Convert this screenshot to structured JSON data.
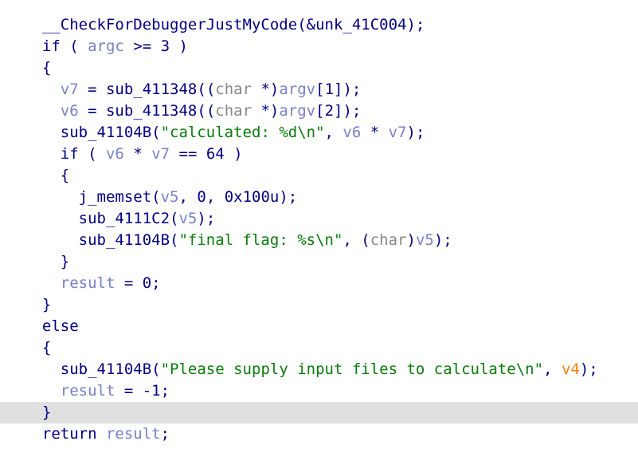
{
  "gutter_numbers": [
    "",
    "",
    "",
    "",
    "",
    "",
    "",
    "",
    "",
    "",
    "",
    "",
    "",
    "",
    "",
    "",
    "",
    "",
    "",
    ""
  ],
  "code_lines": [
    [
      {
        "t": "  ",
        "c": "punc"
      },
      {
        "t": "__CheckForDebuggerJustMyCode",
        "c": "fn"
      },
      {
        "t": "(&unk_41C004);",
        "c": "punc"
      }
    ],
    [
      {
        "t": "  ",
        "c": "punc"
      },
      {
        "t": "if",
        "c": "kw"
      },
      {
        "t": " ( ",
        "c": "punc"
      },
      {
        "t": "argc",
        "c": "var"
      },
      {
        "t": " >= 3 )",
        "c": "punc"
      }
    ],
    [
      {
        "t": "  {",
        "c": "punc"
      }
    ],
    [
      {
        "t": "    ",
        "c": "punc"
      },
      {
        "t": "v7",
        "c": "var"
      },
      {
        "t": " = ",
        "c": "punc"
      },
      {
        "t": "sub_411348",
        "c": "fn"
      },
      {
        "t": "((",
        "c": "punc"
      },
      {
        "t": "char",
        "c": "gray"
      },
      {
        "t": " *)",
        "c": "punc"
      },
      {
        "t": "argv",
        "c": "var"
      },
      {
        "t": "[1]);",
        "c": "punc"
      }
    ],
    [
      {
        "t": "    ",
        "c": "punc"
      },
      {
        "t": "v6",
        "c": "var"
      },
      {
        "t": " = ",
        "c": "punc"
      },
      {
        "t": "sub_411348",
        "c": "fn"
      },
      {
        "t": "((",
        "c": "punc"
      },
      {
        "t": "char",
        "c": "gray"
      },
      {
        "t": " *)",
        "c": "punc"
      },
      {
        "t": "argv",
        "c": "var"
      },
      {
        "t": "[2]);",
        "c": "punc"
      }
    ],
    [
      {
        "t": "    ",
        "c": "punc"
      },
      {
        "t": "sub_41104B",
        "c": "fn"
      },
      {
        "t": "(",
        "c": "punc"
      },
      {
        "t": "\"calculated: %d\\n\"",
        "c": "str"
      },
      {
        "t": ", ",
        "c": "punc"
      },
      {
        "t": "v6",
        "c": "var"
      },
      {
        "t": " * ",
        "c": "punc"
      },
      {
        "t": "v7",
        "c": "var"
      },
      {
        "t": ");",
        "c": "punc"
      }
    ],
    [
      {
        "t": "    ",
        "c": "punc"
      },
      {
        "t": "if",
        "c": "kw"
      },
      {
        "t": " ( ",
        "c": "punc"
      },
      {
        "t": "v6",
        "c": "var"
      },
      {
        "t": " * ",
        "c": "punc"
      },
      {
        "t": "v7",
        "c": "var"
      },
      {
        "t": " == 64 )",
        "c": "punc"
      }
    ],
    [
      {
        "t": "    {",
        "c": "punc"
      }
    ],
    [
      {
        "t": "      ",
        "c": "punc"
      },
      {
        "t": "j_memset",
        "c": "fn"
      },
      {
        "t": "(",
        "c": "punc"
      },
      {
        "t": "v5",
        "c": "var"
      },
      {
        "t": ", 0, 0x100u);",
        "c": "punc"
      }
    ],
    [
      {
        "t": "      ",
        "c": "punc"
      },
      {
        "t": "sub_4111C2",
        "c": "fn"
      },
      {
        "t": "(",
        "c": "punc"
      },
      {
        "t": "v5",
        "c": "var"
      },
      {
        "t": ");",
        "c": "punc"
      }
    ],
    [
      {
        "t": "      ",
        "c": "punc"
      },
      {
        "t": "sub_41104B",
        "c": "fn"
      },
      {
        "t": "(",
        "c": "punc"
      },
      {
        "t": "\"final flag: %s\\n\"",
        "c": "str"
      },
      {
        "t": ", (",
        "c": "punc"
      },
      {
        "t": "char",
        "c": "gray"
      },
      {
        "t": ")",
        "c": "punc"
      },
      {
        "t": "v5",
        "c": "var"
      },
      {
        "t": ");",
        "c": "punc"
      }
    ],
    [
      {
        "t": "    }",
        "c": "punc"
      }
    ],
    [
      {
        "t": "    ",
        "c": "punc"
      },
      {
        "t": "result",
        "c": "var"
      },
      {
        "t": " = 0;",
        "c": "punc"
      }
    ],
    [
      {
        "t": "  }",
        "c": "punc"
      }
    ],
    [
      {
        "t": "  ",
        "c": "punc"
      },
      {
        "t": "else",
        "c": "kw"
      }
    ],
    [
      {
        "t": "  {",
        "c": "punc"
      }
    ],
    [
      {
        "t": "    ",
        "c": "punc"
      },
      {
        "t": "sub_41104B",
        "c": "fn"
      },
      {
        "t": "(",
        "c": "punc"
      },
      {
        "t": "\"Please supply input files to calculate\\n\"",
        "c": "str"
      },
      {
        "t": ", ",
        "c": "punc"
      },
      {
        "t": "v4",
        "c": "orange"
      },
      {
        "t": ");",
        "c": "punc"
      }
    ],
    [
      {
        "t": "    ",
        "c": "punc"
      },
      {
        "t": "result",
        "c": "var"
      },
      {
        "t": " = -1;",
        "c": "punc"
      }
    ],
    [
      {
        "t": "  }",
        "c": "punc"
      }
    ],
    [
      {
        "t": "  ",
        "c": "punc"
      },
      {
        "t": "return",
        "c": "kw"
      },
      {
        "t": " ",
        "c": "punc"
      },
      {
        "t": "result",
        "c": "var"
      },
      {
        "t": ";",
        "c": "punc"
      }
    ]
  ],
  "highlighted_line_index": 18,
  "colors": {
    "keyword": "#000080",
    "variable": "#7781c8",
    "string": "#0a7a0a",
    "highlight_bg": "#e0e0e0",
    "orange_var": "#ff7f00",
    "type_gray": "#888888"
  }
}
